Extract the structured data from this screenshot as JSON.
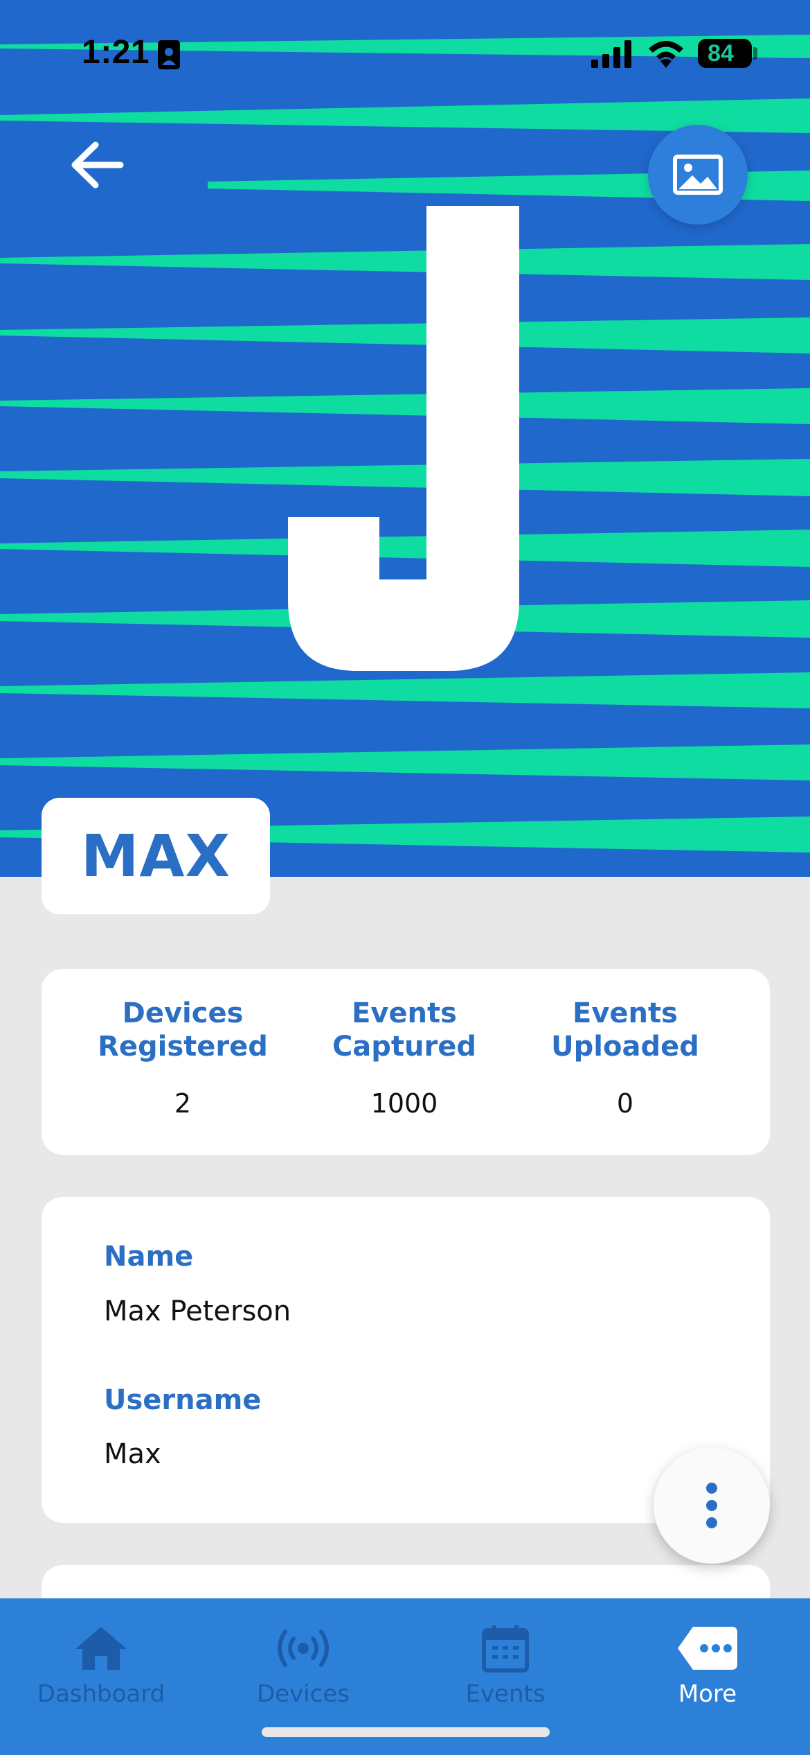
{
  "status_bar": {
    "time": "1:21",
    "battery": "84"
  },
  "hero": {
    "initial": "J",
    "colors": {
      "background": "#2068cc",
      "stripe": "#0fdca0",
      "letter": "#ffffff"
    }
  },
  "profile": {
    "display_name": "MAX"
  },
  "stats": [
    {
      "label": "Devices\nRegistered",
      "value": "2"
    },
    {
      "label": "Events\nCaptured",
      "value": "1000"
    },
    {
      "label": "Events\nUploaded",
      "value": "0"
    }
  ],
  "fields": {
    "name_label": "Name",
    "name_value": "Max Peterson",
    "username_label": "Username",
    "username_value": "Max"
  },
  "nav": {
    "items": [
      {
        "label": "Dashboard",
        "icon": "home-icon"
      },
      {
        "label": "Devices",
        "icon": "broadcast-icon"
      },
      {
        "label": "Events",
        "icon": "calendar-icon"
      },
      {
        "label": "More",
        "icon": "more-icon"
      }
    ],
    "active": "More"
  },
  "theme": {
    "accent": "#2b6fc4",
    "nav_bg": "#2d80d8",
    "page_bg": "#e8e8e8"
  }
}
